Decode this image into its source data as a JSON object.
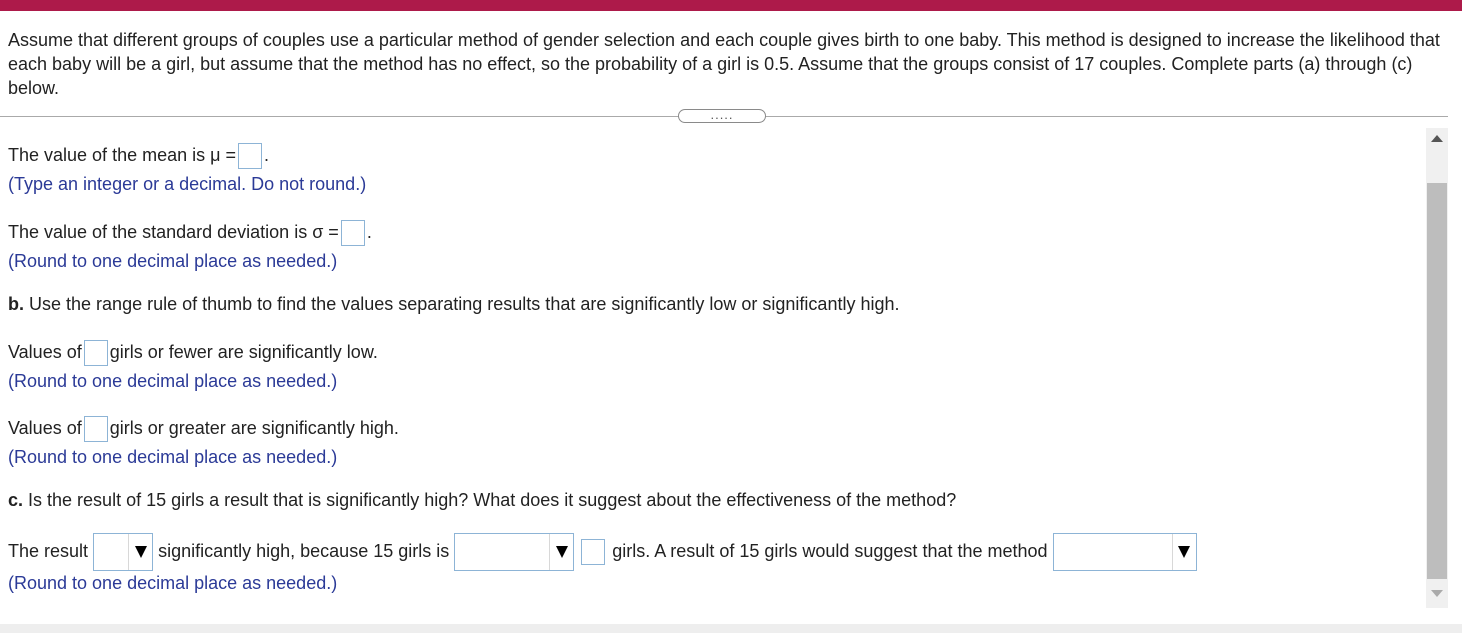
{
  "question": "Assume that different groups of couples use a particular method of gender selection and each couple gives birth to one baby. This method is designed to increase the likelihood that each baby will be a girl, but assume that the method has no effect, so the probability of a girl is 0.5. Assume that the groups consist of 17 couples. Complete parts (a) through (c) below.",
  "expander_label": ".....",
  "mean": {
    "text": "The value of the mean is μ =",
    "suffix": ".",
    "hint": "(Type an integer or a decimal. Do not round.)"
  },
  "std": {
    "text": "The value of the standard deviation is σ =",
    "suffix": ".",
    "hint": "(Round to one decimal place as needed.)"
  },
  "part_b": {
    "label": "b.",
    "text": "Use the range rule of thumb to find the values separating results that are significantly low or significantly high."
  },
  "low": {
    "prefix": "Values of",
    "suffix": "girls or fewer are significantly low.",
    "hint": "(Round to one decimal place as needed.)"
  },
  "high": {
    "prefix": "Values of",
    "suffix": "girls or greater are significantly high.",
    "hint": "(Round to one decimal place as needed.)"
  },
  "part_c": {
    "label": "c.",
    "text": "Is the result of 15 girls a result that is significantly high? What does it suggest about the effectiveness of the method?"
  },
  "result": {
    "prefix": "The result",
    "middle": "significantly high, because 15 girls is",
    "after_box": "girls. A result of 15 girls would suggest that the method",
    "hint": "(Round to one decimal place as needed.)"
  },
  "colors": {
    "top_bar": "#ad1a4a",
    "hint_text": "#2b3a97",
    "input_border": "#8db4d6"
  }
}
